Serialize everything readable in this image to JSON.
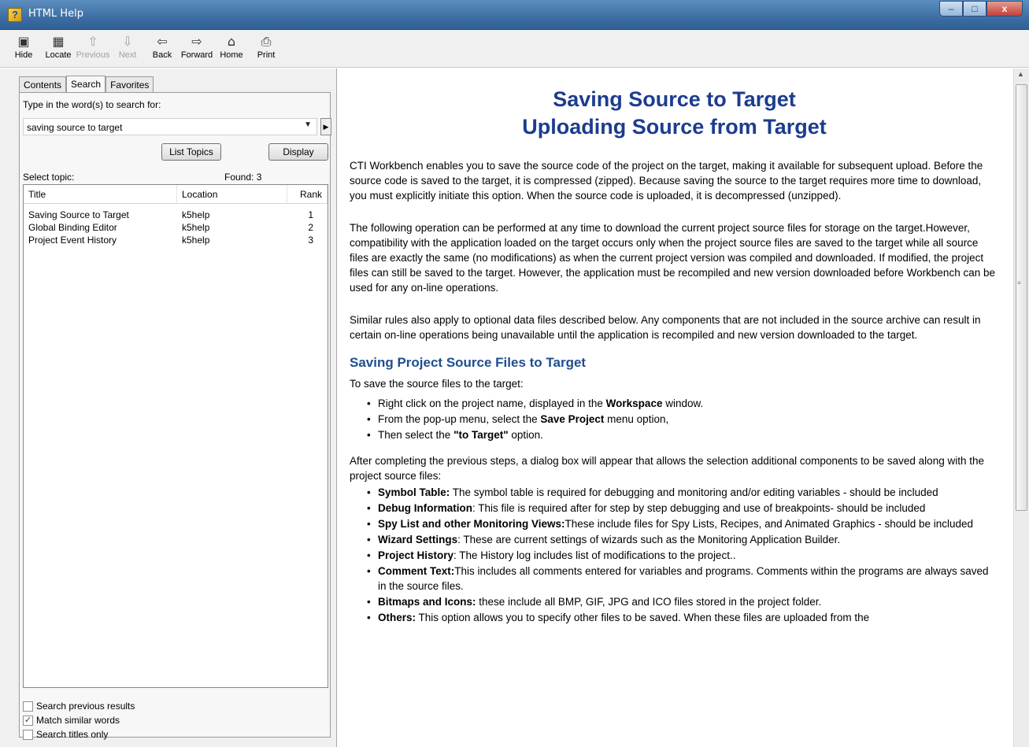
{
  "window": {
    "title": "HTML Help",
    "minimize": "–",
    "maximize": "□",
    "close": "x"
  },
  "toolbar": {
    "buttons": [
      {
        "label": "Hide",
        "icon": "hide-icon",
        "glyph": "▣"
      },
      {
        "label": "Locate",
        "icon": "locate-icon",
        "glyph": "▦"
      },
      {
        "label": "Previous",
        "icon": "up-arrow-icon",
        "glyph": "⇧"
      },
      {
        "label": "Next",
        "icon": "down-arrow-icon",
        "glyph": "⇩"
      },
      {
        "label": "Back",
        "icon": "back-arrow-icon",
        "glyph": "⇦"
      },
      {
        "label": "Forward",
        "icon": "forward-arrow-icon",
        "glyph": "⇨"
      },
      {
        "label": "Home",
        "icon": "home-icon",
        "glyph": "⌂"
      },
      {
        "label": "Print",
        "icon": "printer-icon",
        "glyph": "⎙"
      }
    ]
  },
  "left": {
    "tabs": [
      "Contents",
      "Search",
      "Favorites"
    ],
    "prompt": "Type in the word(s) to search for:",
    "search_value": "saving source to target",
    "list_topics": "List Topics",
    "display": "Display",
    "select_topic": "Select topic:",
    "found": "Found: 3",
    "columns": {
      "title": "Title",
      "location": "Location",
      "rank": "Rank"
    },
    "rows": [
      {
        "title": "Saving Source to Target",
        "location": "k5help",
        "rank": "1"
      },
      {
        "title": "Global Binding Editor",
        "location": "k5help",
        "rank": "2"
      },
      {
        "title": "Project Event History",
        "location": "k5help",
        "rank": "3"
      }
    ],
    "options": [
      {
        "label": "Search previous results",
        "checked": false
      },
      {
        "label": "Match similar words",
        "checked": true
      },
      {
        "label": "Search titles only",
        "checked": false
      }
    ]
  },
  "content": {
    "title_line1": "Saving Source to Target",
    "title_line2": "Uploading Source from Target",
    "para1": "CTI Workbench enables you to save the source code of the project on the target, making it available for subsequent upload. Before the source code is saved to the target, it is compressed (zipped). Because saving the source to the target requires more time to download, you must explicitly initiate this option. When the source code is uploaded, it is decompressed (unzipped).",
    "para2": "The following operation can be performed at any time to download the current project source files for storage on the target.However, compatibility with the application loaded on the target occurs only when the project source files are saved to the target while all source files are exactly the same (no modifications) as when the current project version was compiled and downloaded. If modified, the project files can still be saved to the target. However, the application must be recompiled and new version downloaded before Workbench can be used for any on-line operations.",
    "para3": "Similar rules also apply to optional data files described below. Any components that are not included in the source archive can result in certain on-line operations being unavailable until the application is recompiled and new version downloaded to the target.",
    "subheading": "Saving Project Source Files to Target",
    "intro": "To save the source files to the target:",
    "steps": [
      {
        "pre": "Right click on the project name, displayed in the ",
        "bold": "Workspace",
        "post": " window."
      },
      {
        "pre": "From the pop-up menu, select the ",
        "bold": "Save Project",
        "post": " menu option,"
      },
      {
        "pre": "Then select the ",
        "bold": "\"to Target\"",
        "post": " option."
      }
    ],
    "after": "After completing the previous steps, a dialog box will appear that allows the selection additional components to be saved along with the project source files:",
    "components": [
      {
        "bold": "Symbol Table:",
        "text": " The symbol table is required for debugging and monitoring and/or editing variables - should be included"
      },
      {
        "bold": "Debug Information",
        "text": ": This file is required after for step by step debugging and use of breakpoints- should be included"
      },
      {
        "bold": "Spy List and other Monitoring Views:",
        "text": "These include files for Spy Lists, Recipes, and Animated Graphics - should be included"
      },
      {
        "bold": "Wizard Settings",
        "text": ": These are current settings of wizards such as the Monitoring Application Builder."
      },
      {
        "bold": "Project History",
        "text": ": The History log includes list of modifications to the project.."
      },
      {
        "bold": "Comment Text:",
        "text": "This includes all comments entered for variables and programs. Comments within the programs are always saved in the source files."
      },
      {
        "bold": "Bitmaps and Icons:",
        "text": " these include all BMP, GIF, JPG and ICO files stored in the project folder."
      },
      {
        "bold": "Others:",
        "text": " This option allows you to specify other files to be saved. When these files are uploaded from the"
      }
    ]
  }
}
